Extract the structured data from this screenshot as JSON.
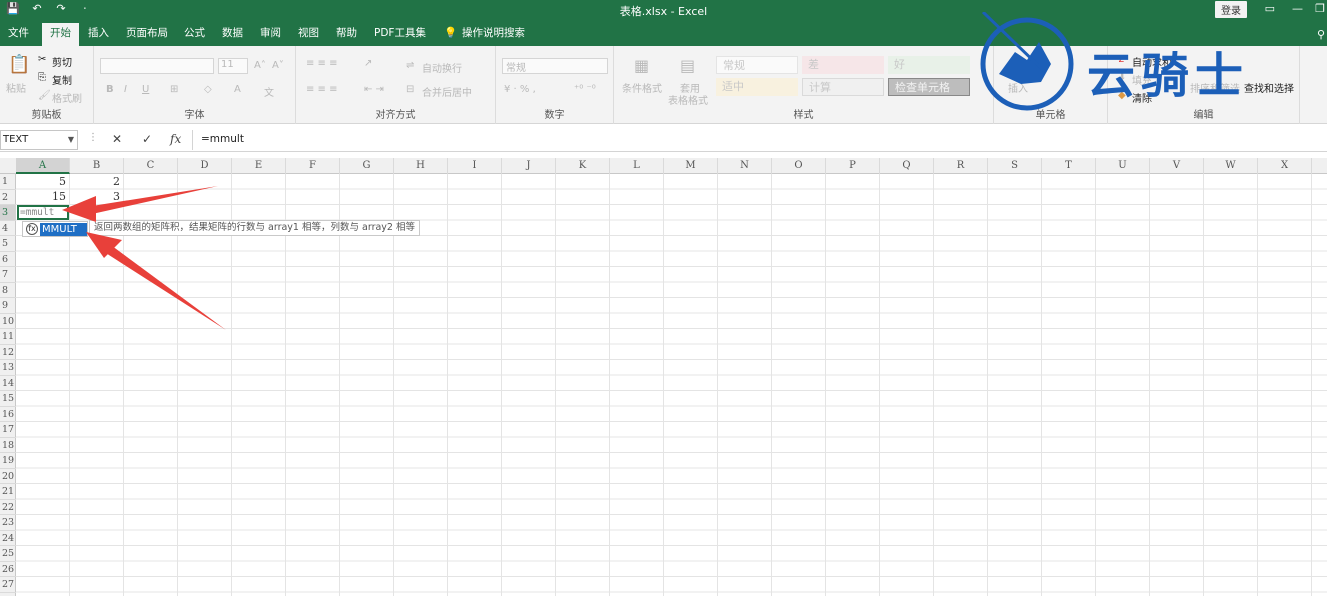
{
  "titlebar": {
    "title": "表格.xlsx  -  Excel",
    "login": "登录",
    "qat": [
      "💾",
      "↶",
      "↷",
      "⋅"
    ]
  },
  "tabs": [
    "文件",
    "开始",
    "插入",
    "页面布局",
    "公式",
    "数据",
    "审阅",
    "视图",
    "帮助",
    "PDF工具集"
  ],
  "active_tab": "开始",
  "tell_me": "操作说明搜索",
  "ribbon": {
    "clipboard": {
      "paste": "粘贴",
      "cut": "剪切",
      "copy": "复制",
      "format_painter": "格式刷",
      "label": "剪贴板"
    },
    "font": {
      "size": "11",
      "label": "字体",
      "bold": "B",
      "italic": "I",
      "underline": "U"
    },
    "alignment": {
      "wrap": "自动换行",
      "merge": "合并后居中",
      "label": "对齐方式"
    },
    "number": {
      "format": "常规",
      "label": "数字"
    },
    "styles": {
      "conditional": "条件格式",
      "table": "套用",
      "table2": "表格格式",
      "cells": [
        "常规",
        "差",
        "好",
        "适中",
        "计算",
        "检查单元格"
      ],
      "label": "样式"
    },
    "cells": {
      "insert": "插入",
      "label": "单元格"
    },
    "editing": {
      "autosum": "自动求和",
      "fill": "填充",
      "clear": "清除",
      "sort": "排序和筛选",
      "find": "查找和选择",
      "label": "编辑"
    }
  },
  "formula_bar": {
    "namebox": "TEXT",
    "cancel": "✕",
    "enter": "✓",
    "fx": "fx",
    "formula": "=mmult"
  },
  "columns": [
    "A",
    "B",
    "C",
    "D",
    "E",
    "F",
    "G",
    "H",
    "I",
    "J",
    "K",
    "L",
    "M",
    "N",
    "O",
    "P",
    "Q",
    "R",
    "S",
    "T",
    "U",
    "V",
    "W",
    "X"
  ],
  "rows": [
    "1",
    "2",
    "3",
    "4",
    "5",
    "6",
    "7",
    "8",
    "9",
    "10",
    "11",
    "12",
    "13",
    "14",
    "15",
    "16",
    "17",
    "18",
    "19",
    "20",
    "21",
    "22",
    "23",
    "24",
    "25",
    "26",
    "27"
  ],
  "cells": {
    "A1": "5",
    "B1": "2",
    "A2": "15",
    "B2": "3"
  },
  "editing_cell": "=mmult",
  "autocomplete": {
    "item": "MMULT",
    "tooltip": "返回两数组的矩阵积，结果矩阵的行数与 array1 相等，列数与 array2 相等"
  },
  "watermark": "云骑士",
  "colors": {
    "accent": "#217346",
    "highlight": "#1f6fc5",
    "arrow": "#e8403a"
  }
}
